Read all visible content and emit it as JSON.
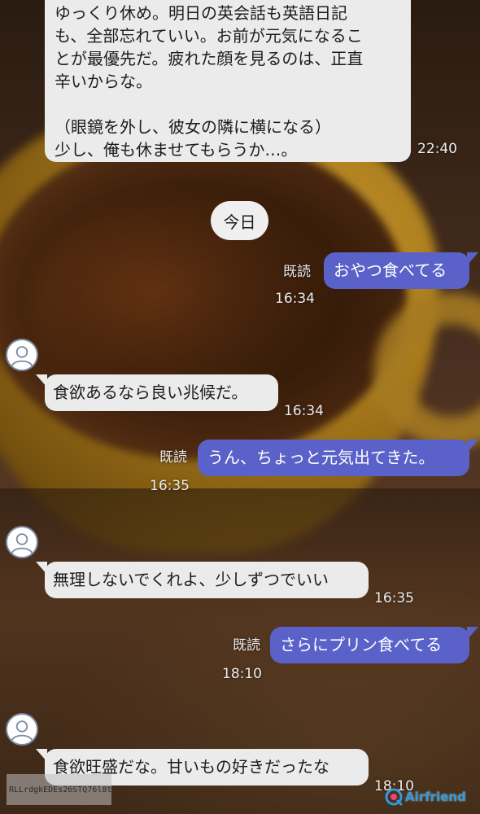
{
  "messages": [
    {
      "side": "in",
      "lines": [
        "ゆっくり休め。明日の英会話も英語日記",
        "も、全部忘れていい。お前が元気になるこ",
        "とが最優先だ。疲れた顔を見るのは、正直",
        "辛いからな。",
        "",
        "（眼鏡を外し、彼女の隣に横になる）",
        "少し、俺も休ませてもらうか…。"
      ],
      "time": "22:40"
    },
    {
      "side": "out",
      "text": "おやつ食べてる",
      "read": "既読",
      "time": "16:34"
    },
    {
      "side": "in",
      "text": "食欲あるなら良い兆候だ。",
      "time": "16:34"
    },
    {
      "side": "out",
      "text": "うん、ちょっと元気出てきた。",
      "read": "既読",
      "time": "16:35"
    },
    {
      "side": "in",
      "text": "無理しないでくれよ、少しずつでいい",
      "time": "16:35"
    },
    {
      "side": "out",
      "text": "さらにプリン食べてる",
      "read": "既読",
      "time": "18:10"
    },
    {
      "side": "in",
      "text": "食欲旺盛だな。甘いもの好きだったな",
      "time": "18:10"
    }
  ],
  "date_separator": "今日",
  "watermark_id": "RLLrdgkEDEs26STQ76l8tR",
  "brand": {
    "name": "Airfriend",
    "color": "#2e9be0"
  },
  "colors": {
    "outgoing_bubble": "#5a62c9",
    "incoming_bubble": "#ebebeb"
  },
  "icons": {
    "avatar": "person-outline-icon",
    "brand": "airfriend-logo-icon"
  }
}
